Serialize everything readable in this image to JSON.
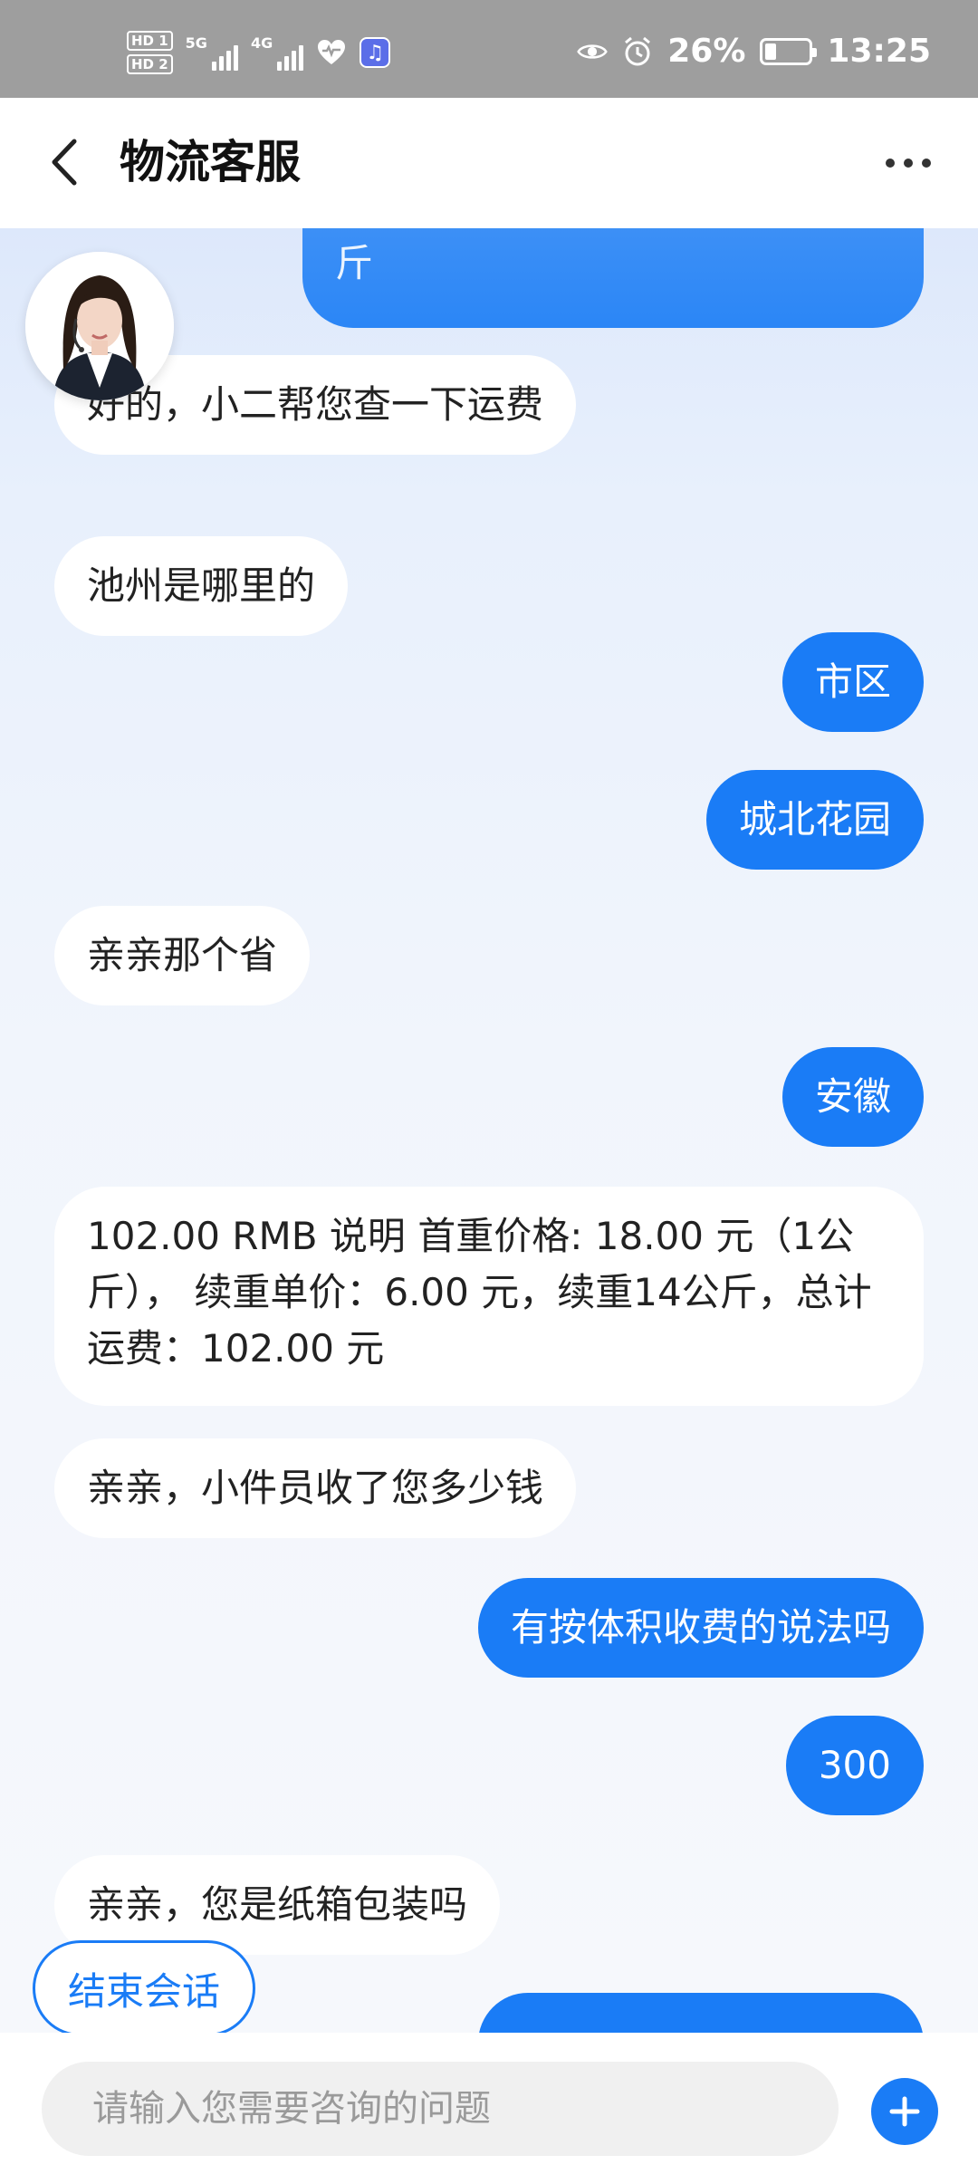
{
  "status_bar": {
    "hd1": "HD 1",
    "hd2": "HD 2",
    "sig1": "5G",
    "sig2": "4G",
    "battery": "26%",
    "battery_level": 0.26,
    "time": "13:25"
  },
  "header": {
    "title": "物流客服",
    "back_icon": "chevron-left-icon",
    "more_icon": "more-horizontal-icon"
  },
  "messages": [
    {
      "side": "right",
      "text": "斤",
      "partial": true
    },
    {
      "side": "left",
      "text": "好的，小二帮您查一下运费"
    },
    {
      "side": "left",
      "text": "池州是哪里的"
    },
    {
      "side": "right",
      "text": "市区"
    },
    {
      "side": "right",
      "text": "城北花园"
    },
    {
      "side": "left",
      "text": "亲亲那个省"
    },
    {
      "side": "right",
      "text": "安徽"
    },
    {
      "side": "left",
      "text": "102.00 RMB 说明 首重价格: 18.00 元（1公斤）， 续重单价：6.00 元，续重14公斤，总计运费：102.00 元"
    },
    {
      "side": "left",
      "text": "亲亲，小件员收了您多少钱"
    },
    {
      "side": "right",
      "text": "有按体积收费的说法吗"
    },
    {
      "side": "right",
      "text": "300"
    },
    {
      "side": "left",
      "text": "亲亲，您是纸箱包装吗"
    },
    {
      "side": "right",
      "text": "",
      "partial": true
    }
  ],
  "end_session_label": "结束会话",
  "input": {
    "placeholder": "请输入您需要咨询的问题",
    "value": ""
  },
  "colors": {
    "accent": "#1a7cf6",
    "status_bar": "#9e9e9e",
    "chat_bg": "#eef3fb"
  }
}
